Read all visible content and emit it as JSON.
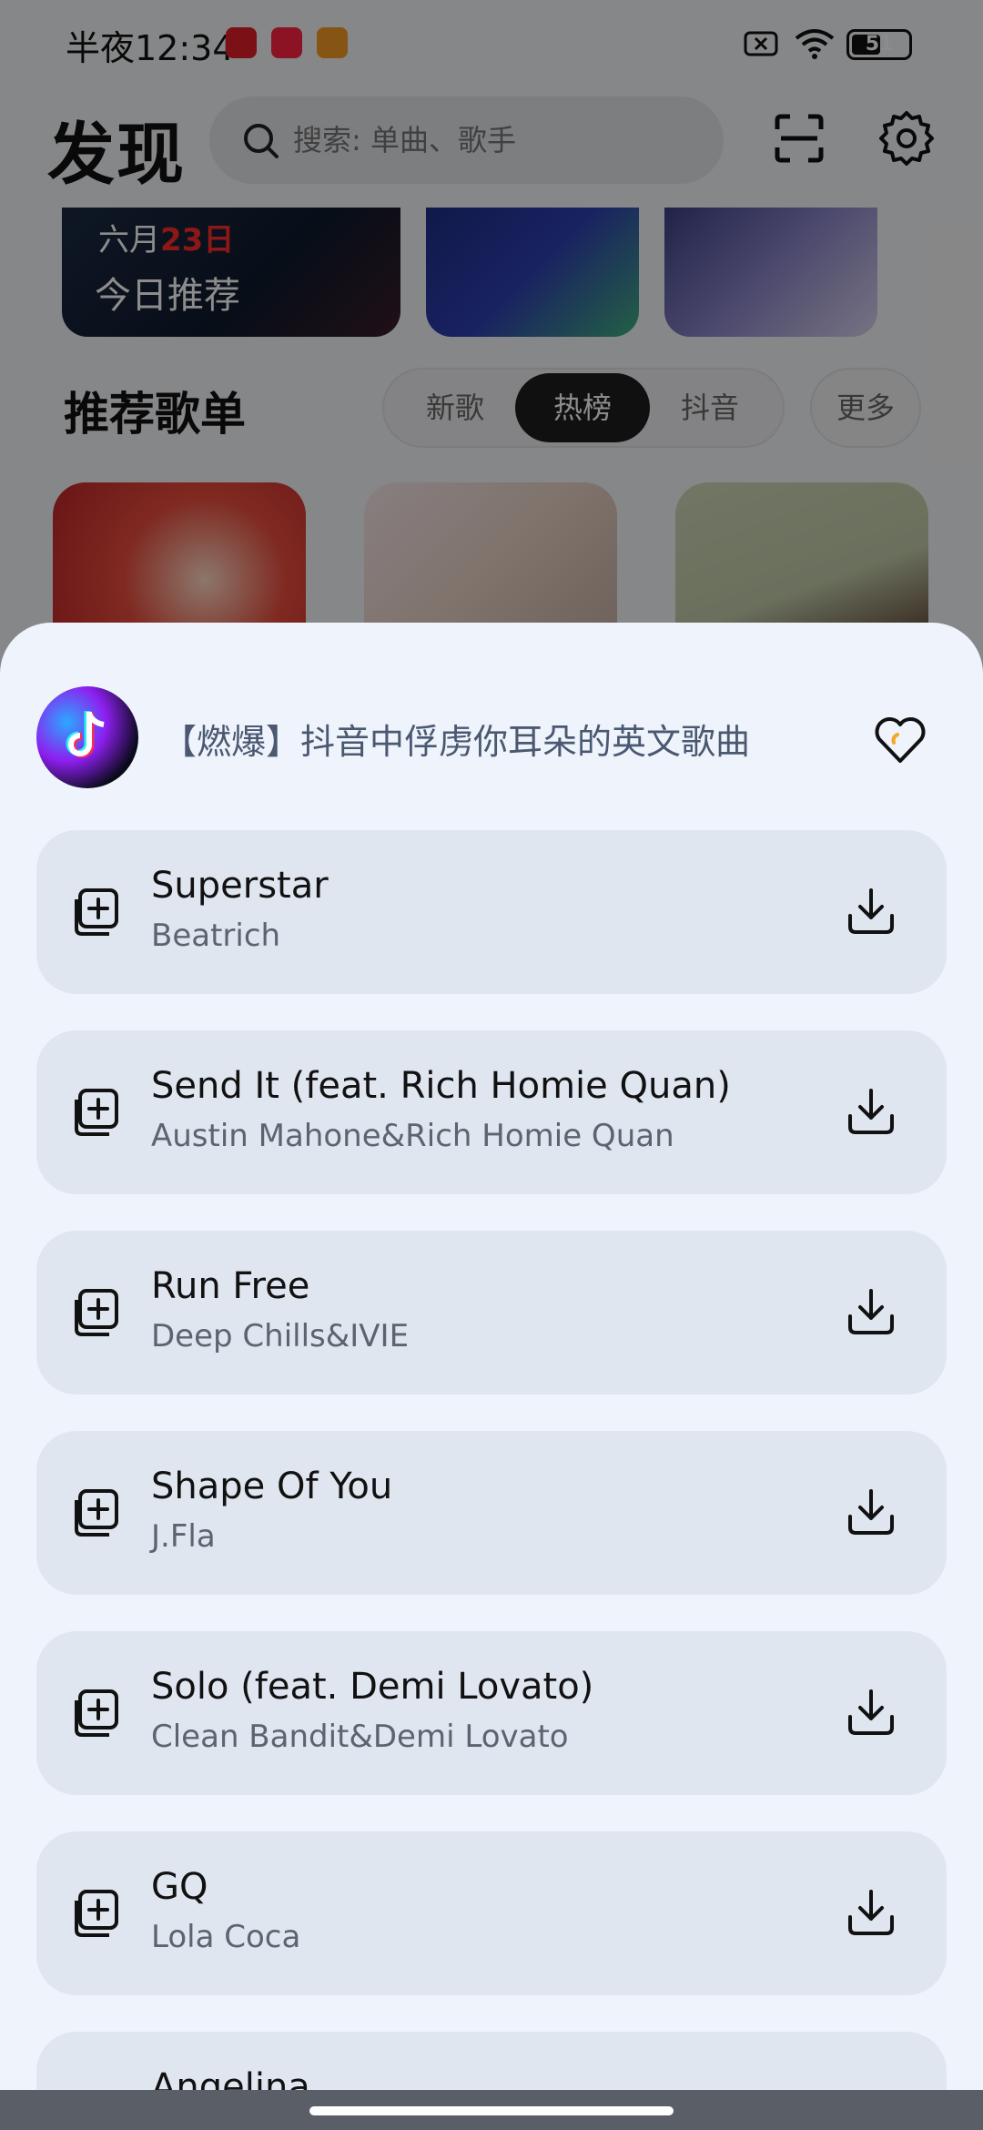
{
  "status_bar": {
    "time": "半夜12:34",
    "battery": "51",
    "battery_fraction": 0.51
  },
  "header": {
    "title": "发现",
    "search_placeholder": "搜索: 单曲、歌手",
    "icons": [
      "search-icon",
      "scan-icon",
      "gear-icon"
    ]
  },
  "banner": {
    "month": "六月",
    "day": "23日",
    "label": "今日推荐"
  },
  "section": {
    "title": "推荐歌单",
    "filters": [
      "新歌",
      "热榜",
      "抖音"
    ],
    "selected_filter": "热榜",
    "more": "更多"
  },
  "sheet": {
    "playlist_title": "【燃爆】抖音中俘虏你耳朵的英文歌曲",
    "songs": [
      {
        "title": "Superstar",
        "artist": "Beatrich"
      },
      {
        "title": "Send It (feat. Rich Homie Quan)",
        "artist": "Austin Mahone&Rich Homie Quan"
      },
      {
        "title": "Run Free",
        "artist": "Deep Chills&IVIE"
      },
      {
        "title": "Shape Of You",
        "artist": "J.Fla"
      },
      {
        "title": "Solo (feat. Demi Lovato)",
        "artist": "Clean Bandit&Demi Lovato"
      },
      {
        "title": "GQ",
        "artist": "Lola Coca"
      },
      {
        "title": "Angelina",
        "artist": ""
      }
    ]
  },
  "colors": {
    "sheet_bg": "#eef3fc",
    "song_item_bg": "#e0e6f0",
    "title_text": "#4a5870",
    "selected_chip": "#1e1e1e"
  }
}
